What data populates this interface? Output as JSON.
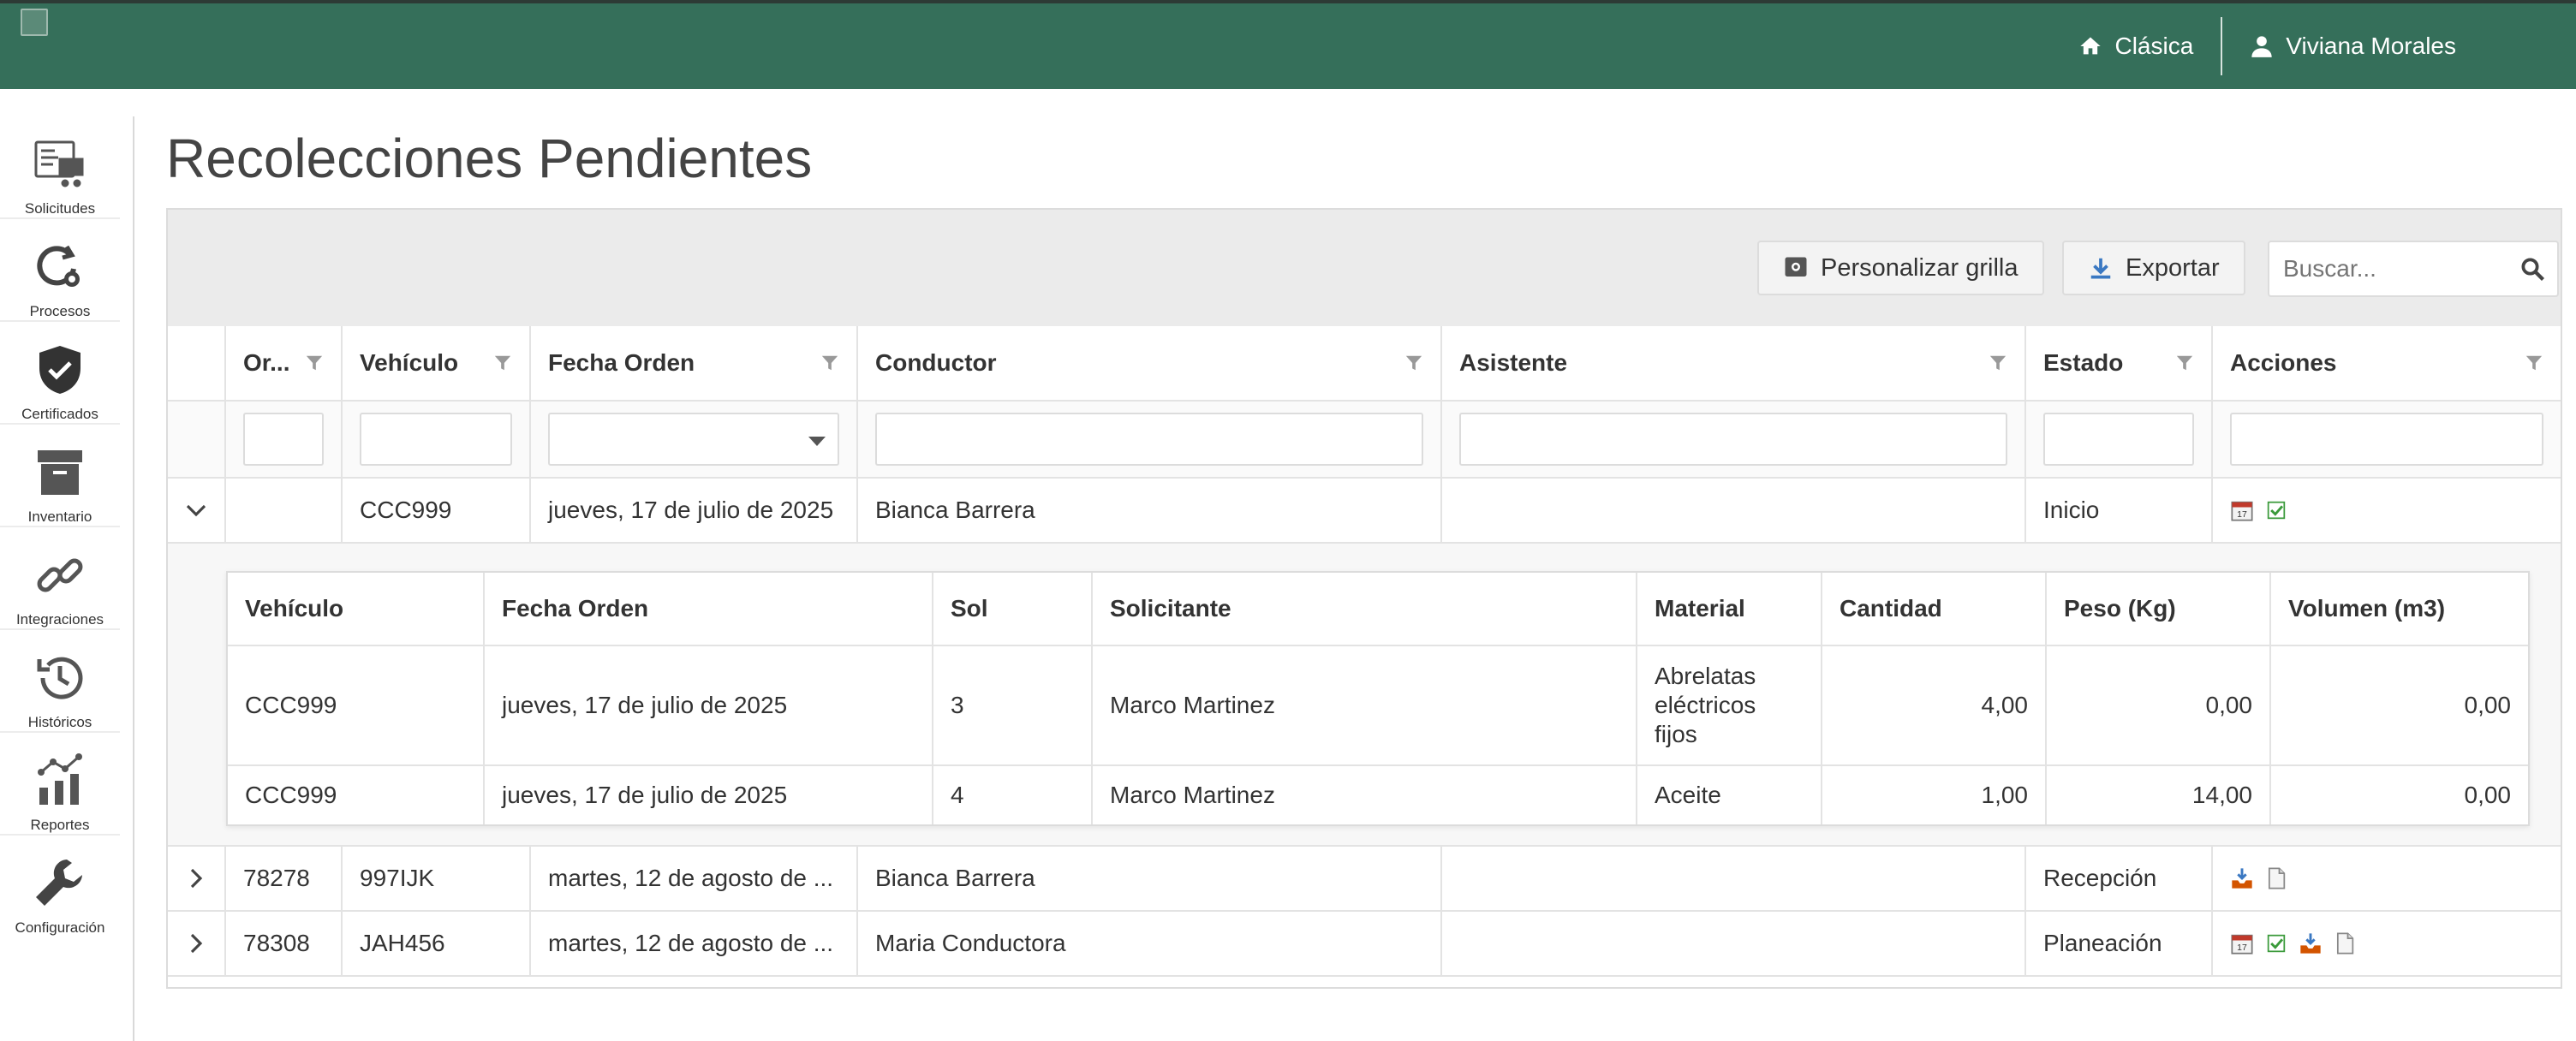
{
  "header": {
    "classic_label": "Clásica",
    "user_name": "Viviana Morales",
    "bar_color": "#356f5a"
  },
  "sidebar": {
    "items": [
      {
        "label": "Solicitudes",
        "icon": "requests-icon"
      },
      {
        "label": "Procesos",
        "icon": "process-gear-icon"
      },
      {
        "label": "Certificados",
        "icon": "shield-check-icon"
      },
      {
        "label": "Inventario",
        "icon": "archive-box-icon"
      },
      {
        "label": "Integraciones",
        "icon": "link-icon"
      },
      {
        "label": "Históricos",
        "icon": "history-clock-icon"
      },
      {
        "label": "Reportes",
        "icon": "chart-icon"
      },
      {
        "label": "Configuración",
        "icon": "wrench-icon"
      }
    ]
  },
  "page": {
    "title": "Recolecciones Pendientes"
  },
  "toolbar": {
    "customize_label": "Personalizar grilla",
    "export_label": "Exportar",
    "search_placeholder": "Buscar..."
  },
  "grid": {
    "columns": [
      "Or...",
      "Vehículo",
      "Fecha Orden",
      "Conductor",
      "Asistente",
      "Estado",
      "Acciones"
    ],
    "rows": [
      {
        "orden": "",
        "vehiculo": "CCC999",
        "fecha": "jueves, 17 de julio de 2025",
        "conductor": "Bianca Barrera",
        "asistente": "",
        "estado": "Inicio",
        "expanded": true,
        "actions": [
          "calendar-icon",
          "check-icon"
        ]
      },
      {
        "orden": "78278",
        "vehiculo": "997IJK",
        "fecha": "martes, 12 de agosto de ...",
        "conductor": "Bianca Barrera",
        "asistente": "",
        "estado": "Recepción",
        "expanded": false,
        "actions": [
          "receive-icon",
          "document-icon"
        ]
      },
      {
        "orden": "78308",
        "vehiculo": "JAH456",
        "fecha": "martes, 12 de agosto de ...",
        "conductor": "Maria Conductora",
        "asistente": "",
        "estado": "Planeación",
        "expanded": false,
        "actions": [
          "calendar-icon",
          "check-icon",
          "receive-icon",
          "document-icon"
        ]
      }
    ]
  },
  "detail": {
    "columns": [
      "Vehículo",
      "Fecha Orden",
      "Sol",
      "Solicitante",
      "Material",
      "Cantidad",
      "Peso (Kg)",
      "Volumen (m3)"
    ],
    "rows": [
      {
        "vehiculo": "CCC999",
        "fecha": "jueves, 17 de julio de 2025",
        "sol": "3",
        "solicitante": "Marco Martinez",
        "material": "Abrelatas eléctricos fijos",
        "cantidad": "4,00",
        "peso": "0,00",
        "volumen": "0,00"
      },
      {
        "vehiculo": "CCC999",
        "fecha": "jueves, 17 de julio de 2025",
        "sol": "4",
        "solicitante": "Marco Martinez",
        "material": "Aceite",
        "cantidad": "1,00",
        "peso": "14,00",
        "volumen": "0,00"
      }
    ]
  }
}
